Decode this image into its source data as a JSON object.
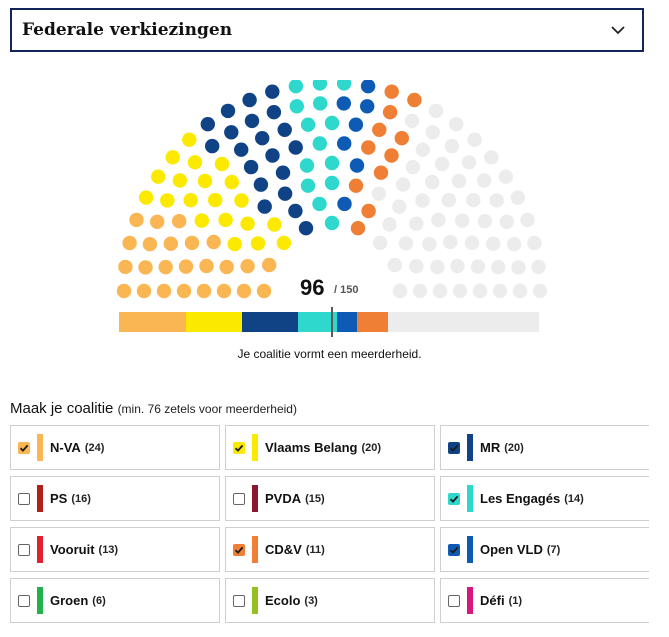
{
  "selector": {
    "label": "Federale verkiezingen",
    "icon": "chevron-down-icon"
  },
  "parliament": {
    "selected_seats": "96",
    "total_seats": "/ 150",
    "majority_message": "Je coalitie vormt een meerderheid.",
    "majority_threshold": 76,
    "empty_color": "#ececec"
  },
  "coalition": {
    "heading": "Maak je coalitie",
    "subheading": "(min. 76 zetels voor meerderheid)",
    "parties": [
      {
        "name": "N-VA",
        "seats": "(24)",
        "seat_count": 24,
        "color": "#fbb654",
        "checked": true,
        "check_color": "#fbb654"
      },
      {
        "name": "Vlaams Belang",
        "seats": "(20)",
        "seat_count": 20,
        "color": "#fce900",
        "checked": true,
        "check_color": "#fce900"
      },
      {
        "name": "MR",
        "seats": "(20)",
        "seat_count": 20,
        "color": "#0f4386",
        "checked": true,
        "check_color": "#0f4386"
      },
      {
        "name": "PS",
        "seats": "(16)",
        "seat_count": 16,
        "color": "#b0211b",
        "checked": false,
        "check_color": "#b0211b"
      },
      {
        "name": "PVDA",
        "seats": "(15)",
        "seat_count": 15,
        "color": "#8c1530",
        "checked": false,
        "check_color": "#8c1530"
      },
      {
        "name": "Les Engagés",
        "seats": "(14)",
        "seat_count": 14,
        "color": "#2ed8cc",
        "checked": true,
        "check_color": "#2ed8cc"
      },
      {
        "name": "Vooruit",
        "seats": "(13)",
        "seat_count": 13,
        "color": "#e3202f",
        "checked": false,
        "check_color": "#e3202f"
      },
      {
        "name": "CD&V",
        "seats": "(11)",
        "seat_count": 11,
        "color": "#ee7f34",
        "checked": true,
        "check_color": "#ee7f34"
      },
      {
        "name": "Open VLD",
        "seats": "(7)",
        "seat_count": 7,
        "color": "#0d5bb5",
        "checked": true,
        "check_color": "#0d5bb5"
      },
      {
        "name": "Groen",
        "seats": "(6)",
        "seat_count": 6,
        "color": "#22b14c",
        "checked": false,
        "check_color": "#22b14c"
      },
      {
        "name": "Ecolo",
        "seats": "(3)",
        "seat_count": 3,
        "color": "#94c11f",
        "checked": false,
        "check_color": "#94c11f"
      },
      {
        "name": "Défi",
        "seats": "(1)",
        "seat_count": 1,
        "color": "#d7177e",
        "checked": false,
        "check_color": "#d7177e"
      }
    ]
  }
}
